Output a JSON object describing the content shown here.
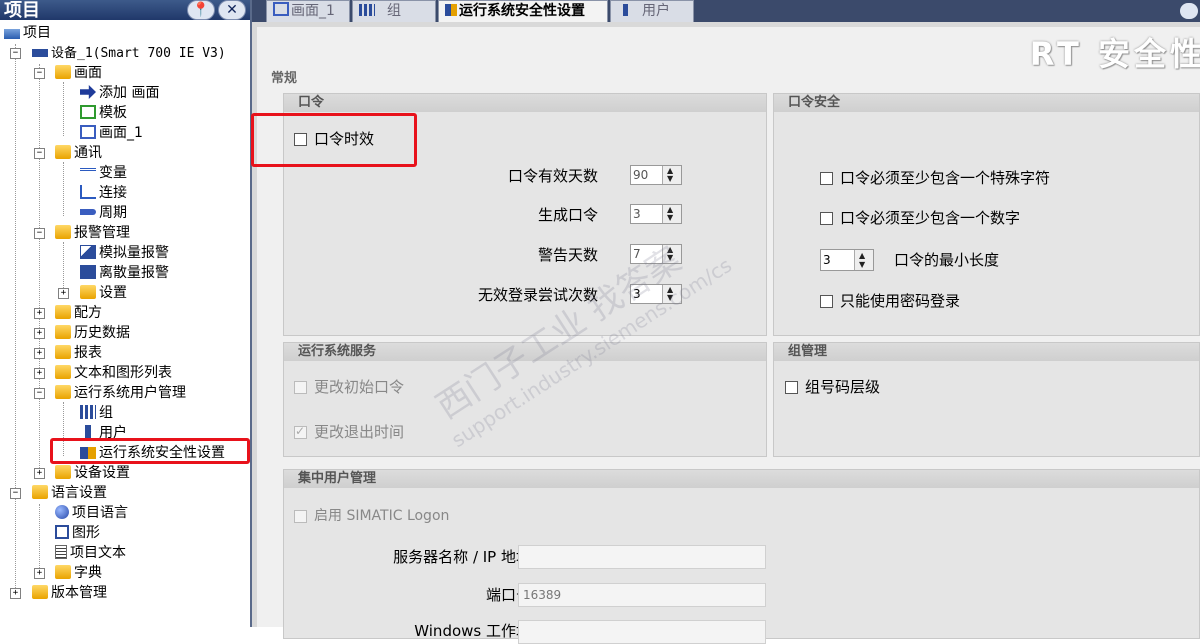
{
  "tree": {
    "header_title": "项目",
    "pin_label": "📍",
    "close_label": "✕",
    "items": [
      {
        "label": "项目"
      },
      {
        "label": "设备_1(Smart 700 IE V3)"
      },
      {
        "label": "画面"
      },
      {
        "label": "添加 画面"
      },
      {
        "label": "模板"
      },
      {
        "label": "画面_1"
      },
      {
        "label": "通讯"
      },
      {
        "label": "变量"
      },
      {
        "label": "连接"
      },
      {
        "label": "周期"
      },
      {
        "label": "报警管理"
      },
      {
        "label": "模拟量报警"
      },
      {
        "label": "离散量报警"
      },
      {
        "label": "设置"
      },
      {
        "label": "配方"
      },
      {
        "label": "历史数据"
      },
      {
        "label": "报表"
      },
      {
        "label": "文本和图形列表"
      },
      {
        "label": "运行系统用户管理"
      },
      {
        "label": "组"
      },
      {
        "label": "用户"
      },
      {
        "label": "运行系统安全性设置"
      },
      {
        "label": "设备设置"
      },
      {
        "label": "语言设置"
      },
      {
        "label": "项目语言"
      },
      {
        "label": "图形"
      },
      {
        "label": "项目文本"
      },
      {
        "label": "字典"
      },
      {
        "label": "版本管理"
      }
    ]
  },
  "tabs": [
    {
      "label": "画面_1"
    },
    {
      "label": "组"
    },
    {
      "label": "运行系统安全性设置"
    },
    {
      "label": "用户"
    }
  ],
  "content": {
    "title": "RT 安全性",
    "section_general": "常规",
    "password": {
      "header": "口令",
      "expiry_checkbox": "口令时效",
      "valid_days_label": "口令有效天数",
      "valid_days_value": "90",
      "generations_label": "生成口令",
      "generations_value": "3",
      "warning_days_label": "警告天数",
      "warning_days_value": "7",
      "invalid_login_label": "无效登录尝试次数",
      "invalid_login_value": "3"
    },
    "password_security": {
      "header": "口令安全",
      "special_char": "口令必须至少包含一个特殊字符",
      "digit": "口令必须至少包含一个数字",
      "min_length_value": "3",
      "min_length_label": "口令的最小长度",
      "password_only": "只能使用密码登录"
    },
    "runtime_services": {
      "header": "运行系统服务",
      "change_initial": "更改初始口令",
      "change_logout": "更改退出时间"
    },
    "group_mgmt": {
      "header": "组管理",
      "group_hierarchy": "组号码层级"
    },
    "central": {
      "header": "集中用户管理",
      "enable": "启用 SIMATIC Logon",
      "server_label": "服务器名称 / IP 地址",
      "server_value": "",
      "port_label": "端口号",
      "port_value": "16389",
      "workgroup_label": "Windows 工作域",
      "workgroup_value": ""
    }
  },
  "watermark": {
    "line1": "西门子工业  找答案",
    "line2": "support.industry.siemens.com/cs"
  },
  "colors": {
    "highlight_red": "#e8121b",
    "title_bar": "#20386a"
  }
}
